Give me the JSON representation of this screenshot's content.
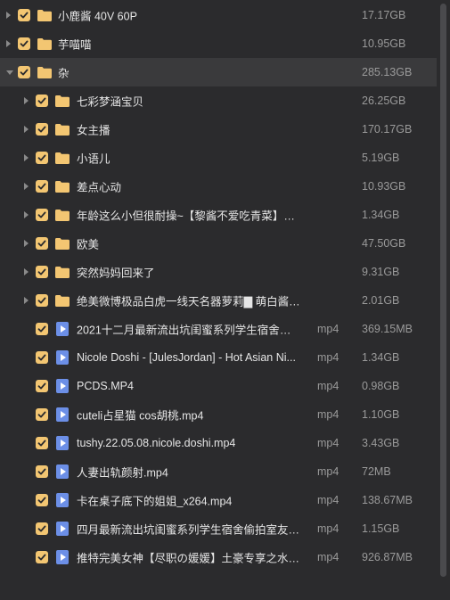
{
  "colors": {
    "checkbox": "#f3c672",
    "folder": "#f3c672",
    "file_icon": "#6c8fe7",
    "background": "#2b2b2d"
  },
  "items": [
    {
      "name": "小鹿酱 40V 60P",
      "size": "17.17GB",
      "type": "",
      "kind": "folder",
      "level": 0,
      "expanded": false,
      "checked": true
    },
    {
      "name": "芋喵喵",
      "size": "10.95GB",
      "type": "",
      "kind": "folder",
      "level": 0,
      "expanded": false,
      "checked": true
    },
    {
      "name": "杂",
      "size": "285.13GB",
      "type": "",
      "kind": "folder",
      "level": 0,
      "expanded": true,
      "checked": true,
      "selected": true
    },
    {
      "name": "七彩梦涵宝贝",
      "size": "26.25GB",
      "type": "",
      "kind": "folder",
      "level": 1,
      "expanded": false,
      "checked": true
    },
    {
      "name": "女主播",
      "size": "170.17GB",
      "type": "",
      "kind": "folder",
      "level": 1,
      "expanded": false,
      "checked": true
    },
    {
      "name": "小语儿",
      "size": "5.19GB",
      "type": "",
      "kind": "folder",
      "level": 1,
      "expanded": false,
      "checked": true
    },
    {
      "name": "差点心动",
      "size": "10.93GB",
      "type": "",
      "kind": "folder",
      "level": 1,
      "expanded": false,
      "checked": true
    },
    {
      "name": "年龄这么小但很耐操~【黎酱不爱吃青菜】放...",
      "size": "1.34GB",
      "type": "",
      "kind": "folder",
      "level": 1,
      "expanded": false,
      "checked": true
    },
    {
      "name": "欧美",
      "size": "47.50GB",
      "type": "",
      "kind": "folder",
      "level": 1,
      "expanded": false,
      "checked": true
    },
    {
      "name": "突然妈妈回来了",
      "size": "9.31GB",
      "type": "",
      "kind": "folder",
      "level": 1,
      "expanded": false,
      "checked": true
    },
    {
      "name": "绝美微博极品白虎一线天名器萝莉▇ 萌白酱▇ 万...",
      "size": "2.01GB",
      "type": "",
      "kind": "folder",
      "level": 1,
      "expanded": false,
      "checked": true
    },
    {
      "name": "2021十二月最新流出坑闺蜜系列学生宿舍偷拍...",
      "size": "369.15MB",
      "type": "mp4",
      "kind": "file",
      "level": 1,
      "checked": true
    },
    {
      "name": "Nicole Doshi - [JulesJordan] - Hot Asian Ni...",
      "size": "1.34GB",
      "type": "mp4",
      "kind": "file",
      "level": 1,
      "checked": true
    },
    {
      "name": "PCDS.MP4",
      "size": "0.98GB",
      "type": "mp4",
      "kind": "file",
      "level": 1,
      "checked": true
    },
    {
      "name": "cuteli占星猫 cos胡桃.mp4",
      "size": "1.10GB",
      "type": "mp4",
      "kind": "file",
      "level": 1,
      "checked": true
    },
    {
      "name": "tushy.22.05.08.nicole.doshi.mp4",
      "size": "3.43GB",
      "type": "mp4",
      "kind": "file",
      "level": 1,
      "checked": true
    },
    {
      "name": "人妻出轨颜射.mp4",
      "size": "72MB",
      "type": "mp4",
      "kind": "file",
      "level": 1,
      "checked": true
    },
    {
      "name": "卡在桌子底下的姐姐_x264.mp4",
      "size": "138.67MB",
      "type": "mp4",
      "kind": "file",
      "level": 1,
      "checked": true
    },
    {
      "name": "四月最新流出坑闺蜜系列学生宿舍偷拍室友躲...",
      "size": "1.15GB",
      "type": "mp4",
      "kind": "file",
      "level": 1,
      "checked": true
    },
    {
      "name": "推特完美女神【尽职の媛媛】土豪专享之水晶...",
      "size": "926.87MB",
      "type": "mp4",
      "kind": "file",
      "level": 1,
      "checked": true
    }
  ]
}
